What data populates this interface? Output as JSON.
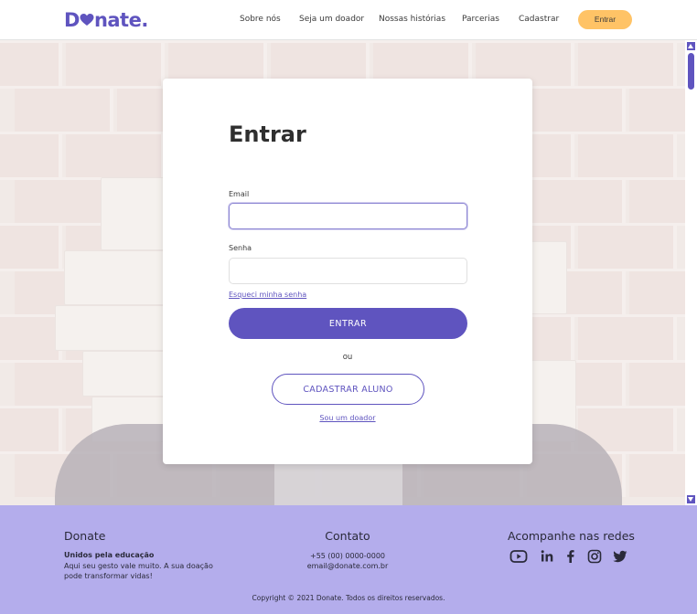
{
  "header": {
    "logo_text_1": "D",
    "logo_text_2": "nate.",
    "nav": [
      "Sobre nós",
      "Seja um doador",
      "Nossas histórias",
      "Parcerias",
      "Cadastrar"
    ],
    "login_button": "Entrar"
  },
  "login": {
    "title": "Entrar",
    "email_label": "Email",
    "email_value": "",
    "password_label": "Senha",
    "password_value": "",
    "forgot": "Esqueci minha senha",
    "submit": "ENTRAR",
    "or": "ou",
    "register_student": "CADASTRAR ALUNO",
    "donor_link": "Sou um doador"
  },
  "footer": {
    "brand_title": "Donate",
    "brand_strong": "Unidos pela educação",
    "brand_text_1": "Aqui seu gesto vale muito. A sua doação",
    "brand_text_2": "pode transformar vidas!",
    "contact_title": "Contato",
    "phone": "+55 (00) 0000-0000",
    "email": "email@donate.com.br",
    "social_title": "Acompanhe nas redes",
    "socials": [
      "youtube-icon",
      "linkedin-icon",
      "facebook-icon",
      "instagram-icon",
      "twitter-icon"
    ],
    "copyright": "Copyright © 2021 Donate. Todos os direitos reservados."
  },
  "colors": {
    "brand": "#5f54bf",
    "accent": "#ffc366",
    "footer_bg": "#b4adec"
  }
}
